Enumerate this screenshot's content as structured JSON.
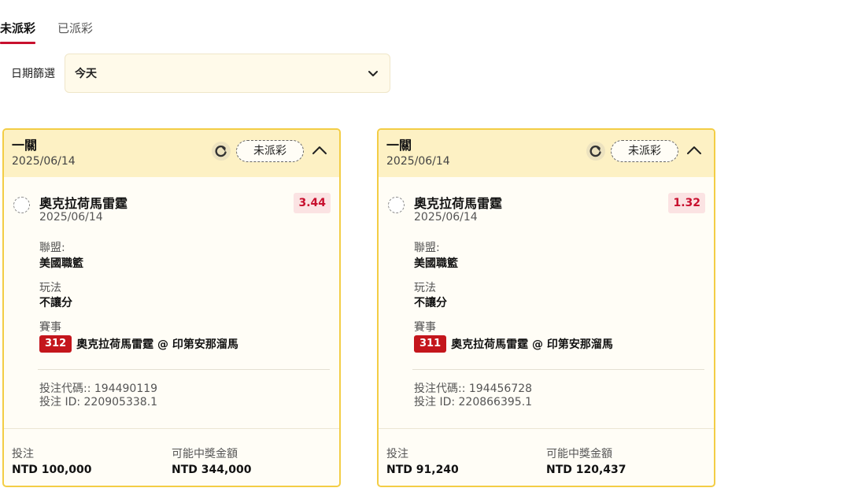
{
  "tabs": [
    {
      "label": "未派彩",
      "active": true
    },
    {
      "label": "已派彩",
      "active": false
    }
  ],
  "filter": {
    "label": "日期篩選",
    "value": "今天",
    "icon": "chevron-down-icon"
  },
  "colors": {
    "accent_red": "#c8102e",
    "card_border": "#f3cd45",
    "card_header_bg": "#fdf1c4",
    "card_bg": "#fffdf6"
  },
  "cards": [
    {
      "header_title": "一關",
      "header_date": "2025/06/14",
      "status": "未派彩",
      "team": "奧克拉荷馬雷霆",
      "team_date": "2025/06/14",
      "odds": "3.44",
      "league_label": "聯盟:",
      "league": "美國職籃",
      "play_label": "玩法",
      "play": "不讓分",
      "event_label": "賽事",
      "event_num": "312",
      "event_name": "奧克拉荷馬雷霆 @ 印第安那溜馬",
      "bet_code": "投注代碼:: 194490119",
      "bet_id": "投注 ID: 220905338.1",
      "stake_label": "投注",
      "stake": "NTD 100,000",
      "payout_label": "可能中獎金額",
      "payout": "NTD 344,000"
    },
    {
      "header_title": "一關",
      "header_date": "2025/06/14",
      "status": "未派彩",
      "team": "奧克拉荷馬雷霆",
      "team_date": "2025/06/14",
      "odds": "1.32",
      "league_label": "聯盟:",
      "league": "美國職籃",
      "play_label": "玩法",
      "play": "不讓分",
      "event_label": "賽事",
      "event_num": "311",
      "event_name": "奧克拉荷馬雷霆 @ 印第安那溜馬",
      "bet_code": "投注代碼:: 194456728",
      "bet_id": "投注 ID: 220866395.1",
      "stake_label": "投注",
      "stake": "NTD 91,240",
      "payout_label": "可能中獎金額",
      "payout": "NTD 120,437"
    }
  ]
}
